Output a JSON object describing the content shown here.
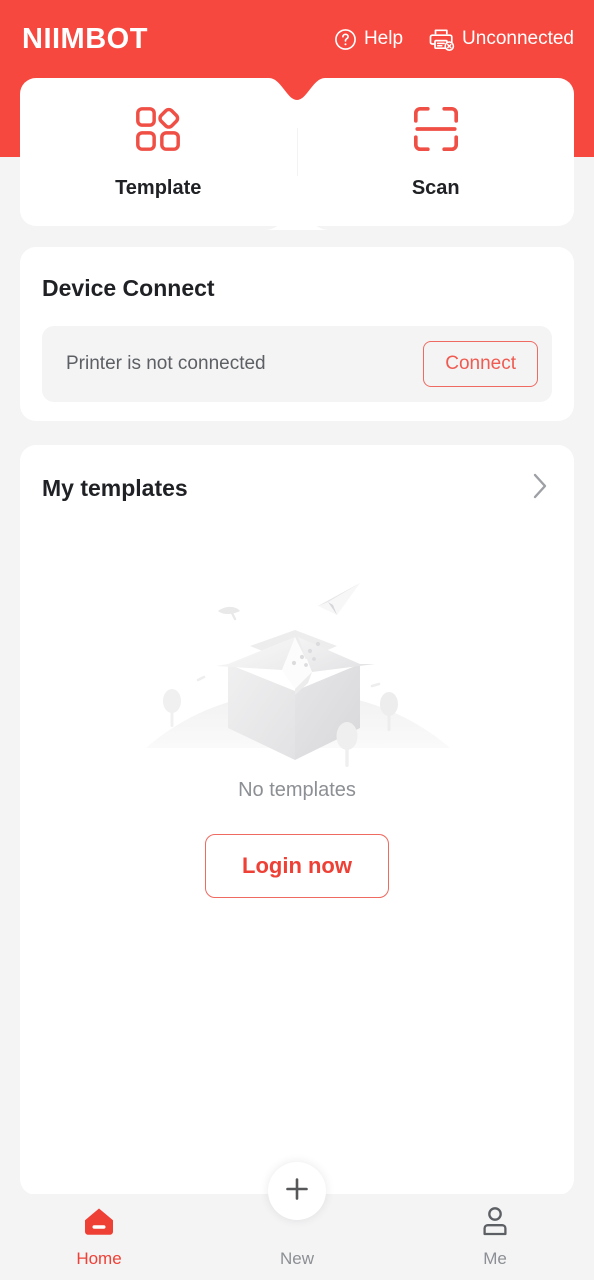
{
  "header": {
    "brand": "NIIMBOT",
    "help_label": "Help",
    "help_icon": "help-circle-icon",
    "connection_label": "Unconnected",
    "connection_icon": "printer-disconnected-icon",
    "background_color": "#f7483f"
  },
  "tabs": [
    {
      "label": "Template",
      "icon": "template-grid-icon"
    },
    {
      "label": "Scan",
      "icon": "scan-frame-icon"
    }
  ],
  "device_connect": {
    "title": "Device Connect",
    "status": "Printer is not connected",
    "button_label": "Connect",
    "button_color": "#ef5b51"
  },
  "my_templates": {
    "title": "My templates",
    "chevron_icon": "chevron-right-icon",
    "empty_illustration": "open-box-paper-plane-illustration",
    "empty_text": "No templates",
    "login_button_label": "Login now",
    "login_button_color": "#ef4036"
  },
  "bottom_nav": {
    "items": [
      {
        "label": "Home",
        "icon": "home-icon",
        "active": true
      },
      {
        "label": "New",
        "icon": "plus-icon",
        "active": false
      },
      {
        "label": "Me",
        "icon": "person-icon",
        "active": false
      }
    ],
    "active_color": "#ef4036",
    "inactive_color": "#8c8f93"
  }
}
